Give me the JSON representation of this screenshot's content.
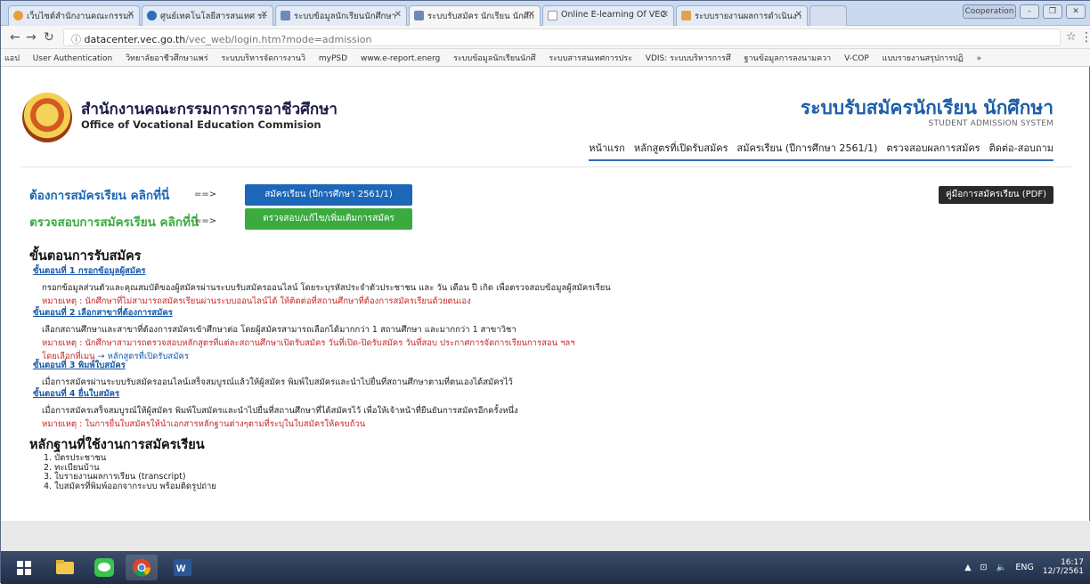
{
  "browser": {
    "tabs": [
      {
        "label": "เว็บไซต์สำนักงานคณะกรรมก",
        "color": "#e8a13a"
      },
      {
        "label": "ศูนย์เทคโนโลยีสารสนเทศ ระ",
        "color": "#2f6fb8"
      },
      {
        "label": "ระบบข้อมูลนักเรียนนักศึกษา",
        "color": "#6c8ab5"
      },
      {
        "label": "ระบบรับสมัคร นักเรียน นักศึก",
        "color": "#6c8ab5"
      },
      {
        "label": "Online E-learning Of VEC",
        "color": "#cccccc"
      },
      {
        "label": "ระบบรายงานผลการดำเนินงา",
        "color": "#e0a24a"
      }
    ],
    "profile_label": "Cooperation",
    "url_host": "datacenter.vec.go.th",
    "url_path": "/vec_web/login.htm?mode=admission",
    "bookmarks": [
      "แอป",
      "User Authentication",
      "วิทยาลัยอาชีวศึกษาแพร่",
      "ระบบบริหารจัดการงานวิ",
      "myPSD",
      "www.e-report.energ",
      "ระบบข้อมูลนักเรียนนักศึ",
      "ระบบสารสนเทศการประ",
      "VDIS: ระบบบริหารการศึ",
      "ฐานข้อมูลการลงนามควา",
      "V-COP",
      "แบบรายงานสรุปการปฏิ",
      "»"
    ]
  },
  "header": {
    "org_th": "สำนักงานคณะกรรมการการอาชีวศึกษา",
    "org_en": "Office of Vocational Education Commision",
    "system_th": "ระบบรับสมัครนักเรียน นักศึกษา",
    "system_en": "STUDENT ADMISSION SYSTEM",
    "nav": [
      "หน้าแรก",
      "หลักสูตรที่เปิดรับสมัคร",
      "สมัครเรียน (ปีการศึกษา 2561/1)",
      "ตรวจสอบผลการสมัคร",
      "ติดต่อ-สอบถาม"
    ]
  },
  "cta": {
    "apply_label": "ต้องการสมัครเรียน คลิกที่นี่",
    "check_label": "ตรวจสอบการสมัครเรียน คลิกที่นี่",
    "arrow": "==>",
    "apply_button": "สมัครเรียน (ปีการศึกษา 2561/1)",
    "check_button": "ตรวจสอบ/แก้ไข/เพิ่มเติมการสมัคร",
    "manual_button": "คู่มือการสมัครเรียน (PDF)"
  },
  "steps_heading": "ขั้นตอนการรับสมัคร",
  "steps": [
    {
      "title": "ขั้นตอนที่ 1 กรอกข้อมูลผู้สมัคร",
      "desc": "กรอกข้อมูลส่วนตัวและคุณสมบัติของผู้สมัครผ่านระบบรับสมัครออนไลน์ โดยระบุรหัสประจำตัวประชาชน และ วัน เดือน ปี เกิด เพื่อตรวจสอบข้อมูลผู้สมัครเรียน",
      "note": "หมายเหตุ : นักศึกษาที่ไม่สามารถสมัครเรียนผ่านระบบออนไลน์ได้ ให้ติดต่อที่สถานศึกษาที่ต้องการสมัครเรียนด้วยตนเอง"
    },
    {
      "title": "ขั้นตอนที่ 2 เลือกสาขาที่ต้องการสมัคร",
      "desc": "เลือกสถานศึกษาและสาขาที่ต้องการสมัครเข้าศึกษาต่อ โดยผู้สมัครสามารถเลือกได้มากกว่า 1 สถานศึกษา และมากกว่า 1 สาขาวิชา",
      "note": "หมายเหตุ : นักศึกษาสามารถตรวจสอบหลักสูตรที่แต่ละสถานศึกษาเปิดรับสมัคร วันที่เปิด-ปิดรับสมัคร วันที่สอบ ประกาศการจัดการเรียนการสอน ฯลฯ",
      "note2": "โดยเลือกที่เมนู",
      "link": "→ หลักสูตรที่เปิดรับสมัคร"
    },
    {
      "title": "ขั้นตอนที่ 3 พิมพ์ใบสมัคร",
      "desc": "เมื่อการสมัครผ่านระบบรับสมัครออนไลน์เสร็จสมบูรณ์แล้วให้ผู้สมัคร พิมพ์ใบสมัครและนำไปยื่นที่สถานศึกษาตามที่ตนเองได้สมัครไว้"
    },
    {
      "title": "ขั้นตอนที่ 4 ยื่นใบสมัคร",
      "desc": "เมื่อการสมัครเสร็จสมบูรณ์ให้ผู้สมัคร พิมพ์ใบสมัครและนำไปยื่นที่สถานศึกษาที่ได้สมัครไว้ เพื่อให้เจ้าหน้าที่ยืนยันการสมัครอีกครั้งหนึ่ง",
      "note": "หมายเหตุ : ในการยื่นใบสมัครให้นำเอกสารหลักฐานต่างๆตามที่ระบุในใบสมัครให้ครบถ้วน"
    }
  ],
  "docs_heading": "หลักฐานที่ใช้งานการสมัครเรียน",
  "docs": [
    "1. บัตรประชาชน",
    "2. ทะเบียนบ้าน",
    "3. ใบรายงานผลการเรียน (transcript)",
    "4. ใบสมัครที่พิมพ์ออกจากระบบ พร้อมติดรูปถ่าย"
  ],
  "taskbar": {
    "lang": "ENG",
    "time": "16:17",
    "date": "12/7/2561"
  }
}
